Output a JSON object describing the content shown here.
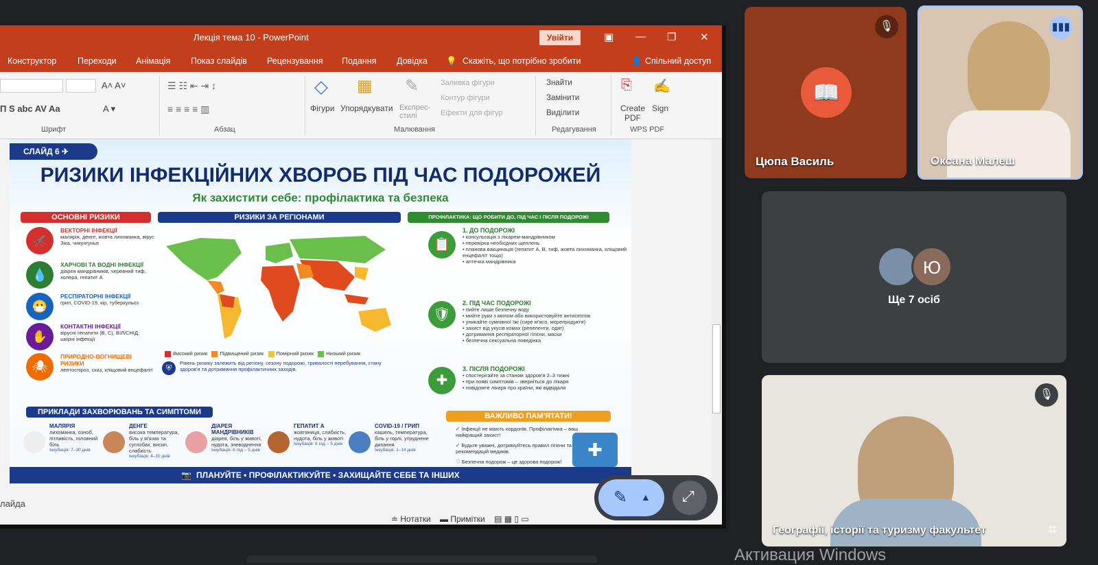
{
  "window": {
    "title": "Лекція тема 10  -  PowerPoint",
    "signin": "Увійти"
  },
  "menu": [
    "Конструктор",
    "Переходи",
    "Анімація",
    "Показ слайдів",
    "Рецензування",
    "Подання",
    "Довідка"
  ],
  "menu_search": "Скажіть, що потрібно зробити",
  "menu_share": "Спільний доступ",
  "ribbon": {
    "font_group": "Шрифт",
    "para_group": "Абзац",
    "draw_group": "Малювання",
    "edit_group": "Редагування",
    "pdf_group": "WPS PDF",
    "shapes": "Фігури",
    "arrange": "Упорядкувати",
    "express": "Експрес-стилі",
    "fill": "Заливка фігури",
    "outline": "Контур фігури",
    "effects": "Ефекти для фігур",
    "find": "Знайти",
    "replace": "Замінити",
    "select": "Виділити",
    "create_pdf": "Create PDF",
    "sign": "Sign"
  },
  "slide": {
    "badge": "СЛАЙД 6",
    "title": "РИЗИКИ ІНФЕКЦІЙНИХ ХВОРОБ ПІД ЧАС ПОДОРОЖЕЙ",
    "subtitle": "Як захистити себе: профілактика та безпека",
    "h_risks": "ОСНОВНІ РИЗИКИ",
    "h_regions": "РИЗИКИ ЗА РЕГІОНАМИ",
    "h_prev": "ПРОФІЛАКТИКА: ЩО РОБИТИ ДО, ПІД ЧАС І ПІСЛЯ ПОДОРОЖІ",
    "risks": [
      {
        "title": "ВЕКТОРНІ ІНФЕКЦІЇ",
        "text": "малярія, денге, жовта лихоманка, вірус Зіка, чикунгунья",
        "color": "#d32f2f"
      },
      {
        "title": "ХАРЧОВІ ТА ВОДНІ ІНФЕКЦІЇ",
        "text": "діарея мандрівників, черевний тиф, холера, гепатит А",
        "color": "#2e7d32"
      },
      {
        "title": "РЕСПІРАТОРНІ ІНФЕКЦІЇ",
        "text": "грип, COVID-19, кір, туберкульоз",
        "color": "#1565c0"
      },
      {
        "title": "КОНТАКТНІ ІНФЕКЦІЇ",
        "text": "вірусні гепатити (В, С), ВІЛ/СНІД, шкірні інфекції",
        "color": "#6a1b9a"
      },
      {
        "title": "ПРИРОДНО-ВОГНИЩЕВІ РИЗИКИ",
        "text": "лептоспіроз, сказ, кліщовий енцефаліт",
        "color": "#ef6c00"
      }
    ],
    "legend": [
      "Високий ризик",
      "Підвищений ризик",
      "Помірний ризик",
      "Низький ризик"
    ],
    "map_note": "Рівень ризику залежить від регіону, сезону подорожі, тривалості перебування, стану здоров'я та дотримання профілактичних заходів.",
    "steps": [
      {
        "title": "1. ДО ПОДОРОЖІ",
        "items": [
          "консультація з лікарем-мандрівником",
          "перевірка необхідних щеплень",
          "планова вакцинація (гепатит А, В, тиф, жовта лихоманка, кліщовий енцефаліт тощо)",
          "аптечка мандрівника"
        ]
      },
      {
        "title": "2. ПІД ЧАС ПОДОРОЖІ",
        "items": [
          "пийте лише безпечну воду",
          "мийте руки з милом або використовуйте антисептик",
          "уникайте сумнівної їжі (сире м'ясо, морепродукти)",
          "захист від укусів комах (репеленти, одяг)",
          "дотримання респіраторної гігієни, маски",
          "безпечна сексуальна поведінка"
        ]
      },
      {
        "title": "3. ПІСЛЯ ПОДОРОЖІ",
        "items": [
          "спостерігайте за станом здоров'я 2–3 тижні",
          "при появі симптомів – зверніться до лікаря",
          "повідомте лікаря про країни, які відвідали"
        ]
      }
    ],
    "h_examples": "ПРИКЛАДИ ЗАХВОРЮВАНЬ ТА СИМПТОМИ",
    "diseases": [
      {
        "name": "МАЛЯРІЯ",
        "text": "лихоманка, озноб, пітливість, головний біль",
        "inc": "Інкубація: 7–30 днів"
      },
      {
        "name": "ДЕНГЕ",
        "text": "висока температура, біль у м'язах та суглобах, висип, слабкість",
        "inc": "Інкубація: 4–10 днів"
      },
      {
        "name": "ДІАРЕЯ МАНДРІВНИКІВ",
        "text": "діарея, біль у животі, нудота, зневоднення",
        "inc": "Інкубація: 6 год – 5 днів"
      },
      {
        "name": "ГЕПАТИТ А",
        "text": "жовтяниця, слабкість, нудота, біль у животі",
        "inc": "Інкубація: 6 год – 5 днів"
      },
      {
        "name": "COVID-19 / ГРИП",
        "text": "кашель, температура, біль у горлі, утруднене дихання",
        "inc": "Інкубація: 1–14 днів"
      }
    ],
    "h_important": "ВАЖЛИВО ПАМ'ЯТАТИ!",
    "important": [
      "Інфекції не мають кордонів. Профілактика – ваш найкращий захист!",
      "Будьте уважні, дотримуйтесь правил гігієни та рекомендацій медиків.",
      "Безпечна подорож – це здорова подорож!"
    ],
    "footer": "ПЛАНУЙТЕ  •  ПРОФІЛАКТИКУЙТЕ  •  ЗАХИЩАЙТЕ СЕБЕ ТА ІНШИХ"
  },
  "notes_placeholder": "лайда",
  "status": {
    "notes": "Нотатки",
    "comments": "Примітки"
  },
  "participants": [
    {
      "name": "Цюпа Василь"
    },
    {
      "name": "Оксана Малеш"
    },
    {
      "name": "Географії, історії та туризму факультет"
    }
  ],
  "others": {
    "count_label": "Ще 7 осіб",
    "initial": "Ю"
  },
  "activation": "Активация Windows"
}
